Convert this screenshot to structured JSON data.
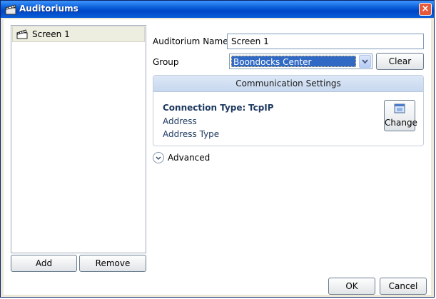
{
  "window": {
    "title": "Auditoriums",
    "icon": "clapperboard-icon",
    "close_label": "×"
  },
  "list": {
    "items": [
      {
        "label": "Screen 1",
        "icon": "clapperboard-icon"
      }
    ]
  },
  "list_buttons": {
    "add": "Add",
    "remove": "Remove"
  },
  "form": {
    "name_label": "Auditorium Name",
    "name_value": "Screen 1",
    "group_label": "Group",
    "group_value": "Boondocks Center",
    "clear_label": "Clear"
  },
  "comm": {
    "header": "Communication Settings",
    "conn_type_label": "Connection Type:",
    "conn_type_value": "TcpIP",
    "address_label": "Address",
    "address_type_label": "Address Type",
    "change_label": "Change",
    "change_icon": "window-settings-icon"
  },
  "advanced": {
    "label": "Advanced",
    "icon": "chevron-down-icon"
  },
  "footer": {
    "ok": "OK",
    "cancel": "Cancel"
  }
}
